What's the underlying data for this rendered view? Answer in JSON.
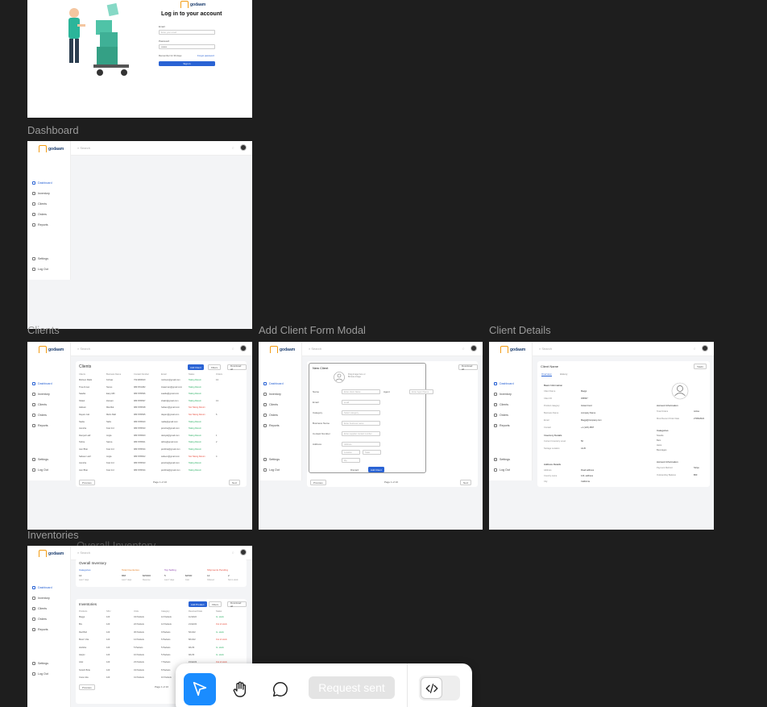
{
  "labels": {
    "dashboard": "Dashboard",
    "clients": "Clients",
    "add_client": "Add Client Form Modal",
    "client_details": "Client Details",
    "inventories": "Inventories"
  },
  "brand": {
    "name": "godaam",
    "accent": "#2a63d4",
    "logo_color": "#f39c12"
  },
  "login": {
    "title": "Log in to your account",
    "email_label": "Email",
    "email_placeholder": "Enter your email",
    "password_label": "Password",
    "password_value": "••••••••",
    "remember": "Remember for 30 days",
    "forgot": "Forgot password",
    "submit": "Sign in"
  },
  "app": {
    "search": "Search",
    "nav": [
      "Dashboard",
      "Inventory",
      "Clients",
      "Orders",
      "Reports"
    ],
    "settings": "Settings",
    "logout": "Log Out"
  },
  "clients_screen": {
    "title": "Clients",
    "add_btn": "Add Client",
    "filters_btn": "Filters",
    "download_btn": "Download all",
    "columns": [
      "Clients",
      "Business Name",
      "Contact Number",
      "Email",
      "Status",
      "Orders"
    ],
    "rows": [
      [
        "Mohsen Malik",
        "Kohsar",
        "7621384620",
        "mohsen@gmail.com",
        "Taking Return",
        "13"
      ],
      [
        "Tina Arman",
        "Nexus",
        "9847451382",
        "tinaarman@gmail.com",
        "Taking Return",
        ""
      ],
      [
        "Saadia",
        "Easy Mill",
        "9847155696",
        "saadia@gmail.com",
        "Taking Return",
        ""
      ],
      [
        "Shakir",
        "Zamani",
        "9847455697",
        "shakir@gmail.com",
        "Taking Return",
        "13"
      ],
      [
        "Hafsam",
        "Mal-Mal",
        "9847155638",
        "hafsam@gmail.com",
        "Not Taking Return",
        ""
      ],
      [
        "Dayam Jatt",
        "Mehs Mall",
        "9847155695",
        "dayam@gmail.com",
        "Not Taking Return",
        "6"
      ],
      [
        "Nadia",
        "Nafis",
        "9847155620",
        "nadia@gmail.com",
        "Taking Return",
        ""
      ],
      [
        "Jamsha",
        "Koel Ind",
        "9847155633",
        "jamsha@gmail.com",
        "Taking Return",
        ""
      ],
      [
        "Daniyal Latif",
        "Angle",
        "9847155600",
        "daniyal@gmail.com",
        "Taking Return",
        "1"
      ],
      [
        "Tahira",
        "Saima",
        "9847155601",
        "tahira@gmail.com",
        "Taking Return",
        "2"
      ],
      [
        "Jam Bhai",
        "Koel Ind",
        "9847155634",
        "jambhai@gmail.com",
        "Taking Return",
        ""
      ],
      [
        "Sabeen Latif",
        "Angle",
        "9847155602",
        "sabeen@gmail.com",
        "Not Taking Return",
        "4"
      ],
      [
        "Jamsha",
        "Koel Ind",
        "9847155633",
        "jamsha@gmail.com",
        "Taking Return",
        ""
      ],
      [
        "Jam Bhai",
        "Koel Ind",
        "9847155634",
        "jambhai@gmail.com",
        "Taking Return",
        ""
      ]
    ],
    "prev": "Previous",
    "page": "Page 1 of 10",
    "next": "Next"
  },
  "modal": {
    "title": "New Client",
    "upload": "Drag image here or Browse image",
    "fields": [
      {
        "label": "Name",
        "placeholder": "Enter client Name"
      },
      {
        "label": "Email",
        "placeholder": "email"
      },
      {
        "label": "Category",
        "placeholder": "Select category"
      },
      {
        "label": "Business Name",
        "placeholder": "Enter business name"
      },
      {
        "label": "Contact Number",
        "placeholder": "Enter supplier contact number"
      },
      {
        "label": "Address",
        "placeholder": "Address"
      }
    ],
    "agent_label": "Agent",
    "agent_placeholder": "Enter Agent Name",
    "city": "Location",
    "state": "State",
    "zip": "Zip",
    "discard": "Discard",
    "add": "Add Client"
  },
  "details": {
    "title": "Client Name",
    "edit": "Edit",
    "tabs": [
      "Overview",
      "History"
    ],
    "basic_info": "Basic Information",
    "basic": [
      [
        "Client Name",
        "Maqgi"
      ],
      [
        "Client ID",
        "456567"
      ],
      [
        "Product category",
        "Instant food"
      ],
      [
        "Business Name",
        "company Name"
      ],
      [
        "Email",
        "Maggi@company.com"
      ],
      [
        "Contact",
        "+1 (123) 4567"
      ]
    ],
    "inventory_details": "Inventory Details",
    "inventory": [
      [
        "Current Inventory Level",
        "50"
      ],
      [
        "Storage Location",
        "A1-B"
      ]
    ],
    "address_details": "Address Details",
    "address": [
      [
        "Address",
        "Road address"
      ],
      [
        "Country name",
        "123, address"
      ],
      [
        "City",
        "California"
      ]
    ],
    "account_info": "Account Information",
    "account": [
      [
        "Total Orders",
        "Active"
      ],
      [
        "Most Recent Order Date",
        "27/06/2024"
      ]
    ],
    "categories": "Categories",
    "category_list": [
      "Snacks",
      "Bars",
      "Jams",
      "Beverages"
    ],
    "account_info2": "Account Information",
    "account2": [
      [
        "Payment Method",
        "Stripe"
      ],
      [
        "Outstanding Balance",
        "$50"
      ]
    ]
  },
  "inventory_screen": {
    "overall_title": "Overall Inventory",
    "ghost_title": "Overall Inventory",
    "stats": [
      {
        "title": "Categories",
        "color": "#2a63d4",
        "value": "14",
        "sub": "Last 7 days"
      },
      {
        "title": "Total Inventories",
        "color": "#e67e22",
        "value": "868",
        "sub": "Last 7 days",
        "value2": "$25000",
        "sub2": "Revenue"
      },
      {
        "title": "Top Selling",
        "color": "#8e44ad",
        "value": "5",
        "sub": "Last 7 days",
        "value2": "$2500",
        "sub2": "Cost"
      },
      {
        "title": "Shipments Pending",
        "color": "#e74c3c",
        "value": "12",
        "sub": "Ordered",
        "value2": "2",
        "sub2": "Not in stock"
      }
    ],
    "title": "Inventories",
    "add_btn": "Add Product",
    "filters_btn": "Filters",
    "download_btn": "Download all",
    "columns": [
      "Products",
      "SKU",
      "Units",
      "Category",
      "Received Date",
      "Status"
    ],
    "rows": [
      [
        "Maggi",
        "123",
        "43 Packets",
        "12 Packets",
        "11/12/22",
        "In- stock"
      ],
      [
        "Bru",
        "123",
        "22 Packets",
        "12 Packets",
        "21/12/22",
        "Out of stock"
      ],
      [
        "Red Bull",
        "123",
        "36 Packets",
        "9 Packets",
        "5/12/22",
        "In- stock"
      ],
      [
        "Bourn Vita",
        "123",
        "14 Packets",
        "6 Packets",
        "8/12/22",
        "Out of stock"
      ],
      [
        "Horlicks",
        "123",
        "5 Packets",
        "5 Packets",
        "9/1/23",
        "In- stock"
      ],
      [
        "Harpic",
        "123",
        "10 Packets",
        "5 Packets",
        "9/1/23",
        "In- stock"
      ],
      [
        "Ariel",
        "123",
        "23 Packets",
        "7 Packets",
        "15/12/23",
        "Out of stock"
      ],
      [
        "Scotch Brite",
        "123",
        "43 Packets",
        "8 Packets",
        "6/6/23",
        "In- stock"
      ],
      [
        "Coca cola",
        "123",
        "41 Packets",
        "10 Packets",
        "11/11/22",
        "Low stock"
      ]
    ],
    "prev": "Previous",
    "page": "Page 1 of 10"
  },
  "toolbar": {
    "request_sent": "Request sent",
    "icons": [
      "cursor-icon",
      "hand-icon",
      "comment-icon",
      "code-icon"
    ]
  }
}
